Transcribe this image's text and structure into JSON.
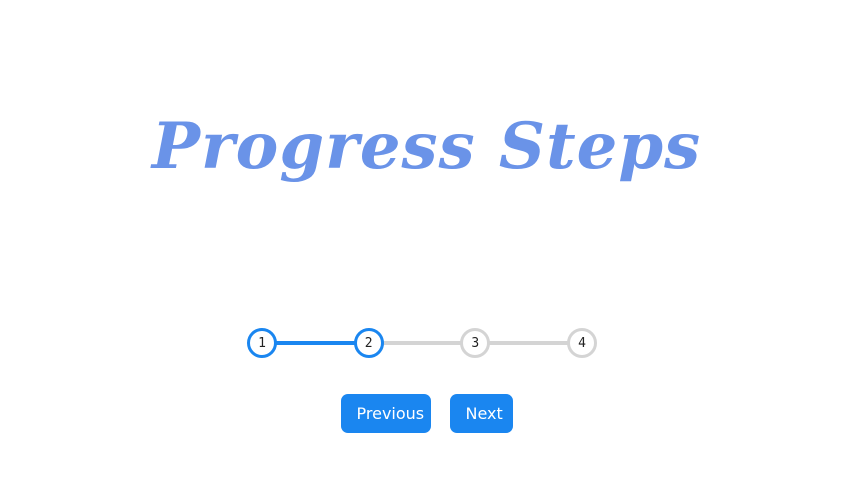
{
  "title": "Progress Steps",
  "progress": {
    "current_step": 2,
    "total_steps": 4,
    "steps": [
      {
        "label": "1",
        "active": true
      },
      {
        "label": "2",
        "active": true
      },
      {
        "label": "3",
        "active": false
      },
      {
        "label": "4",
        "active": false
      }
    ]
  },
  "buttons": {
    "previous_label": "Previous",
    "next_label": "Next"
  },
  "colors": {
    "accent": "#1a86f0",
    "inactive": "#d4d4d4",
    "title": "#6a93e8"
  }
}
